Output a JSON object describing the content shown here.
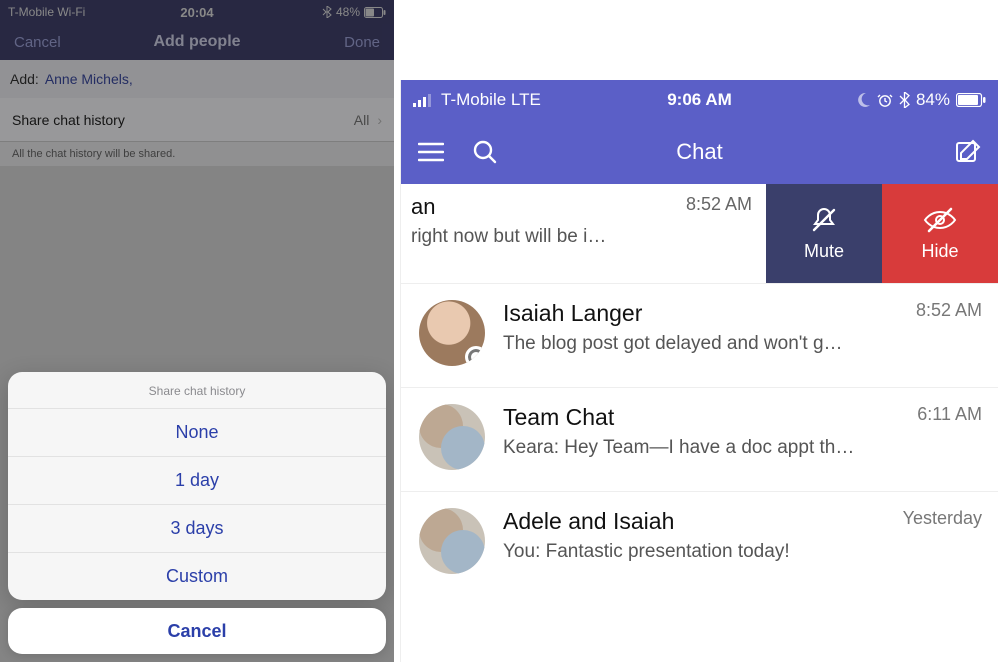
{
  "left": {
    "status": {
      "carrier": "T-Mobile Wi-Fi",
      "time": "20:04",
      "battery": "48%"
    },
    "nav": {
      "cancel": "Cancel",
      "title": "Add people",
      "done": "Done"
    },
    "add": {
      "label": "Add:",
      "person": "Anne Michels,"
    },
    "shareRow": {
      "label": "Share chat history",
      "value": "All",
      "chevron": "›"
    },
    "note": "All the chat history will be shared.",
    "sheet": {
      "title": "Share chat history",
      "options": [
        "None",
        "1 day",
        "3 days",
        "Custom"
      ],
      "cancel": "Cancel"
    }
  },
  "right": {
    "status": {
      "carrier": "T-Mobile  LTE",
      "time": "9:06 AM",
      "battery": "84%"
    },
    "top": {
      "title": "Chat"
    },
    "swiped": {
      "name_fragment": "an",
      "time": "8:52 AM",
      "preview": "right now but will be i…",
      "mute": "Mute",
      "hide": "Hide"
    },
    "items": [
      {
        "name": "Isaiah Langer",
        "time": "8:52 AM",
        "preview": "The blog post got delayed and won't g…"
      },
      {
        "name": "Team Chat",
        "time": "6:11 AM",
        "preview": "Keara: Hey Team—I have a doc appt th…"
      },
      {
        "name": "Adele and Isaiah",
        "time": "Yesterday",
        "preview": "You: Fantastic presentation today!"
      }
    ]
  }
}
